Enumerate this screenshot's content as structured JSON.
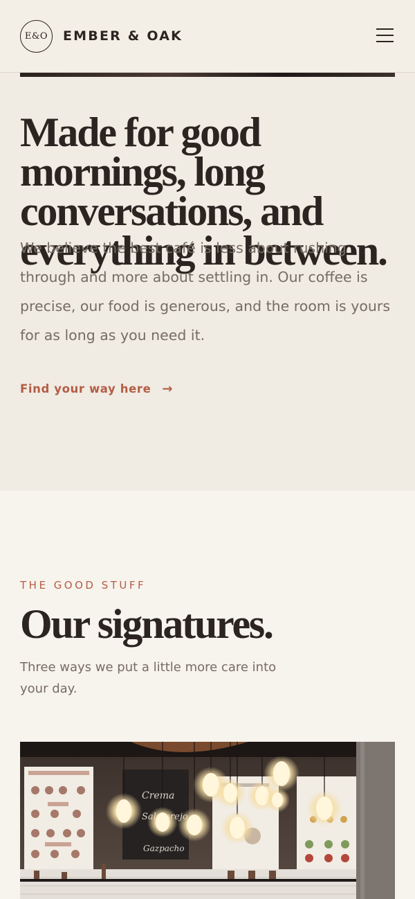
{
  "header": {
    "logo_mark": "E&O",
    "brand_name": "EMBER & OAK",
    "menu_icon": "hamburger-menu-icon"
  },
  "intro": {
    "title": "Made for good mornings, long conversations, and everything in between.",
    "body": "We believe the best café is less about rushing through and more about settling in. Our coffee is precise, our food is generous, and the room is yours for as long as you need it.",
    "link_label": "Find your way here",
    "link_icon": "arrow-right-icon",
    "link_arrow": "→"
  },
  "signatures": {
    "eyebrow": "THE GOOD STUFF",
    "title": "Our signatures.",
    "body": "Three ways we put a little more care into your day."
  },
  "photo": {
    "board_text_1": "Crema",
    "board_text_2": "Salmorejo",
    "board_text_3": "Gazpacho"
  },
  "colors": {
    "accent": "#b45d45",
    "text_dark": "#2b2420",
    "text_muted": "#766c64",
    "intro_bg": "#f0ebe3",
    "page_bg": "#f7f3ed"
  }
}
